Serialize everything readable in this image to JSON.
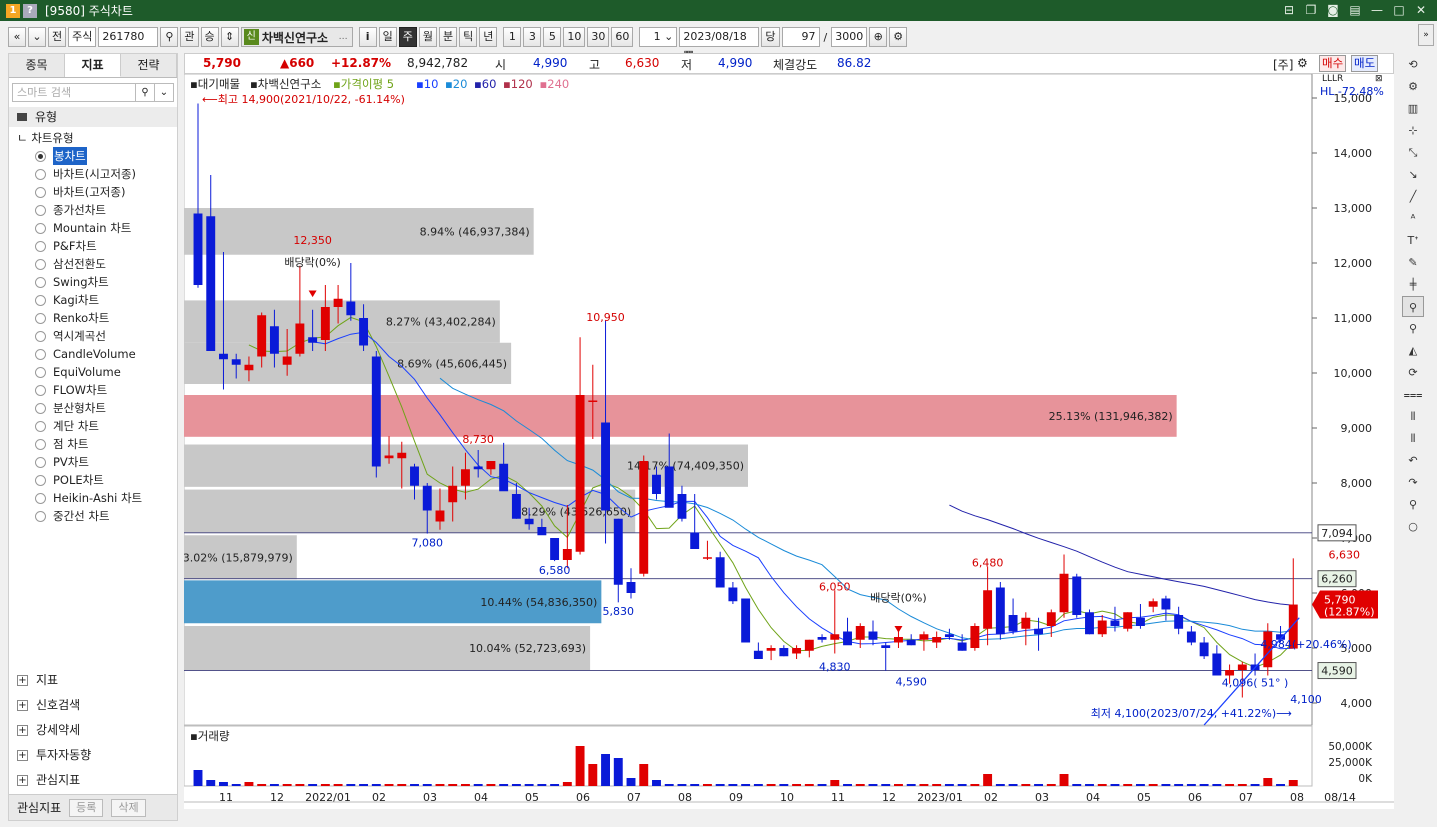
{
  "titlebar": {
    "icon1": "1",
    "icon2": "?",
    "title": "[9580] 주식차트",
    "controls": [
      "pin-icon",
      "copy-icon",
      "camera-icon",
      "print-icon",
      "minimize-icon",
      "maximize-icon",
      "close-icon"
    ]
  },
  "toolbar": {
    "prev": "«",
    "next": "»",
    "market": "전",
    "type": "주식",
    "code": "261780",
    "gwan": "관",
    "seung": "승",
    "badge": "신",
    "corp_name": "차백신연구소",
    "info": "i",
    "periods": [
      "일",
      "주",
      "월",
      "분",
      "틱",
      "년"
    ],
    "active_period": "주",
    "units": [
      "1",
      "3",
      "5",
      "10",
      "30",
      "60"
    ],
    "unit_select": "1",
    "date": "2023/08/18",
    "dang": "당",
    "count": "97",
    "slash": "/",
    "total": "3000"
  },
  "left_panel": {
    "tabs": [
      "종목",
      "지표",
      "전략"
    ],
    "active_tab": "지표",
    "search_placeholder": "스마트 검색",
    "section": "유형",
    "tree_root": "차트유형",
    "selected": "봉차트",
    "items": [
      "봉차트",
      "바차트(시고저종)",
      "바차트(고저종)",
      "종가선차트",
      "Mountain 차트",
      "P&F차트",
      "삼선전환도",
      "Swing차트",
      "Kagi차트",
      "Renko차트",
      "역시계곡선",
      "CandleVolume",
      "EquiVolume",
      "FLOW차트",
      "분산형차트",
      "계단 차트",
      "점 차트",
      "PV차트",
      "POLE차트",
      "Heikin-Ashi 차트",
      "중간선 차트"
    ],
    "groups": [
      "지표",
      "신호검색",
      "강세약세",
      "투자자동향",
      "관심지표"
    ],
    "bottom_label": "관심지표",
    "bottom_buttons": [
      "등록",
      "삭제"
    ]
  },
  "infobar": {
    "price": "5,790",
    "change": "▲660",
    "change_pct": "+12.87%",
    "volume": "8,942,782",
    "open_label": "시",
    "open": "4,990",
    "high_label": "고",
    "high": "6,630",
    "low_label": "저",
    "low": "4,990",
    "strength_label": "체결강도",
    "strength": "86.82",
    "ju": "[주]",
    "buy": "매수",
    "sell": "매도"
  },
  "chart_data": {
    "type": "candlestick",
    "legend": [
      "대기매물",
      "차백신연구소",
      "가격이평 5",
      "10",
      "20",
      "60",
      "120",
      "240"
    ],
    "legend_colors": [
      "#222222",
      "#222222",
      "#6fa318",
      "#1a3fff",
      "#1a8bd8",
      "#2222aa",
      "#b0304a",
      "#e07090"
    ],
    "y_ticks": [
      4000,
      5000,
      6000,
      7000,
      8000,
      9000,
      10000,
      11000,
      12000,
      13000,
      14000,
      15000
    ],
    "y_tick_labels": [
      "4,000",
      "5,000",
      "6,000",
      "7,000",
      "8,000",
      "9,000",
      "10,000",
      "11,000",
      "12,000",
      "13,000",
      "14,000",
      "15,000"
    ],
    "ylim": [
      3600,
      15400
    ],
    "x_labels": [
      "11",
      "12",
      "2022/01",
      "02",
      "03",
      "04",
      "05",
      "06",
      "07",
      "08",
      "09",
      "10",
      "11",
      "12",
      "2023/01",
      "02",
      "03",
      "04",
      "05",
      "06",
      "07",
      "08",
      "08/14"
    ],
    "hl_label": "HL -72.48%",
    "volume_profile": [
      {
        "price_low": 12150,
        "price_high": 13000,
        "label": "8.94% (46,937,384)",
        "len": 0.31,
        "highlight": "none"
      },
      {
        "price_low": 10550,
        "price_high": 11320,
        "label": "8.27% (43,402,284)",
        "len": 0.28,
        "highlight": "none"
      },
      {
        "price_low": 9800,
        "price_high": 10550,
        "label": "8.69% (45,606,445)",
        "len": 0.29,
        "highlight": "none"
      },
      {
        "price_low": 8840,
        "price_high": 9600,
        "label": "25.13% (131,946,382)",
        "len": 0.88,
        "highlight": "red"
      },
      {
        "price_low": 7930,
        "price_high": 8700,
        "label": "14.17% (74,409,350)",
        "len": 0.5,
        "highlight": "none"
      },
      {
        "price_low": 7090,
        "price_high": 7880,
        "label": "8.29% (43,526,650)",
        "len": 0.4,
        "highlight": "none"
      },
      {
        "price_low": 6250,
        "price_high": 7050,
        "label": "3.02% (15,879,979)",
        "len": 0.1,
        "highlight": "none"
      },
      {
        "price_low": 5450,
        "price_high": 6230,
        "label": "10.44% (54,836,350)",
        "len": 0.37,
        "highlight": "blue"
      },
      {
        "price_low": 4600,
        "price_high": 5400,
        "label": "10.04% (52,723,693)",
        "len": 0.36,
        "highlight": "none"
      }
    ],
    "candles": [
      [
        12900,
        14900,
        11550,
        11600
      ],
      [
        12850,
        13600,
        10550,
        10400
      ],
      [
        10350,
        12200,
        9700,
        10250
      ],
      [
        10250,
        10350,
        9900,
        10150
      ],
      [
        10050,
        10300,
        9850,
        10150
      ],
      [
        10300,
        11100,
        10100,
        11050
      ],
      [
        10850,
        11150,
        10100,
        10350
      ],
      [
        10150,
        10800,
        9950,
        10300
      ],
      [
        10350,
        11950,
        10300,
        10900
      ],
      [
        10650,
        11150,
        10400,
        10550
      ],
      [
        10600,
        11600,
        10400,
        11200
      ],
      [
        11200,
        11600,
        10900,
        11350
      ],
      [
        11300,
        12000,
        10950,
        11050
      ],
      [
        11000,
        11250,
        10400,
        10500
      ],
      [
        10300,
        10400,
        8100,
        8300
      ],
      [
        8450,
        8850,
        8350,
        8500
      ],
      [
        8450,
        8750,
        7900,
        8550
      ],
      [
        8300,
        8350,
        7700,
        7950
      ],
      [
        7950,
        8000,
        7080,
        7500
      ],
      [
        7300,
        7900,
        7150,
        7500
      ],
      [
        7650,
        8300,
        7300,
        7950
      ],
      [
        7950,
        8550,
        7700,
        8250
      ],
      [
        8300,
        8600,
        8100,
        8250
      ],
      [
        8250,
        8350,
        8150,
        8400
      ],
      [
        8350,
        8730,
        8100,
        7850
      ],
      [
        7800,
        8000,
        7350,
        7350
      ],
      [
        7350,
        7550,
        7150,
        7250
      ],
      [
        7200,
        7350,
        7100,
        7050
      ],
      [
        7000,
        7000,
        6580,
        6600
      ],
      [
        6600,
        7600,
        6450,
        6800
      ],
      [
        6750,
        10650,
        6700,
        9600
      ],
      [
        9500,
        10150,
        8800,
        9500
      ],
      [
        9100,
        10950,
        6900,
        7500
      ],
      [
        7350,
        7350,
        5830,
        6150
      ],
      [
        6200,
        6450,
        5900,
        6000
      ],
      [
        6350,
        8500,
        6300,
        8400
      ],
      [
        8150,
        8300,
        7700,
        7800
      ],
      [
        8300,
        8900,
        7600,
        7550
      ],
      [
        7800,
        7950,
        7300,
        7350
      ],
      [
        7100,
        7800,
        6850,
        6800
      ],
      [
        6650,
        6950,
        6600,
        6650
      ],
      [
        6650,
        6750,
        6100,
        6100
      ],
      [
        6100,
        6200,
        5800,
        5850
      ],
      [
        5900,
        5900,
        5100,
        5100
      ],
      [
        4950,
        5100,
        4800,
        4800
      ],
      [
        4950,
        5050,
        4780,
        5000
      ],
      [
        5000,
        5050,
        4850,
        4850
      ],
      [
        4900,
        5050,
        4800,
        5000
      ],
      [
        4950,
        5150,
        4830,
        5150
      ],
      [
        5200,
        5250,
        5100,
        5150
      ],
      [
        5150,
        6050,
        4900,
        5250
      ],
      [
        5300,
        5550,
        5180,
        5050
      ],
      [
        5150,
        5450,
        5000,
        5400
      ],
      [
        5300,
        5500,
        5050,
        5150
      ],
      [
        5050,
        5100,
        4590,
        5000
      ],
      [
        5100,
        5300,
        5000,
        5200
      ],
      [
        5150,
        5250,
        5050,
        5050
      ],
      [
        5150,
        5300,
        4950,
        5250
      ],
      [
        5100,
        5300,
        5000,
        5200
      ],
      [
        5250,
        5350,
        5150,
        5200
      ],
      [
        5100,
        5250,
        4950,
        4950
      ],
      [
        5000,
        5450,
        4950,
        5400
      ],
      [
        5350,
        6480,
        5050,
        6050
      ],
      [
        6100,
        6200,
        5150,
        5250
      ],
      [
        5600,
        5900,
        5250,
        5300
      ],
      [
        5350,
        5650,
        5050,
        5550
      ],
      [
        5350,
        5550,
        4950,
        5250
      ],
      [
        5400,
        5700,
        5200,
        5650
      ],
      [
        5650,
        6700,
        5550,
        6350
      ],
      [
        6300,
        6350,
        5550,
        5600
      ],
      [
        5650,
        5700,
        5250,
        5250
      ],
      [
        5250,
        5600,
        5200,
        5500
      ],
      [
        5500,
        5750,
        5300,
        5400
      ],
      [
        5350,
        5650,
        5300,
        5650
      ],
      [
        5550,
        5800,
        5350,
        5400
      ],
      [
        5750,
        5900,
        5650,
        5850
      ],
      [
        5900,
        5950,
        5500,
        5700
      ],
      [
        5600,
        5750,
        5250,
        5350
      ],
      [
        5300,
        5400,
        5050,
        5100
      ],
      [
        5100,
        5200,
        4800,
        4850
      ],
      [
        4900,
        5050,
        4550,
        4500
      ],
      [
        4500,
        4700,
        4350,
        4600
      ],
      [
        4600,
        4750,
        4100,
        4700
      ],
      [
        4700,
        4900,
        4500,
        4600
      ],
      [
        4650,
        5450,
        4500,
        5300
      ],
      [
        5250,
        5400,
        5100,
        5150
      ],
      [
        4990,
        6630,
        4990,
        5790
      ]
    ],
    "annotations": [
      {
        "text": "⟵최고 14,900(2021/10/22, -61.14%)",
        "kind": "max"
      },
      {
        "text": "12,350",
        "kind": "red"
      },
      {
        "text": "배당락(0%)",
        "kind": "black"
      },
      {
        "text": "10,950",
        "kind": "red"
      },
      {
        "text": "8,730",
        "kind": "red"
      },
      {
        "text": "7,080",
        "kind": "blue"
      },
      {
        "text": "6,580",
        "kind": "blue"
      },
      {
        "text": "5,830",
        "kind": "blue"
      },
      {
        "text": "6,050",
        "kind": "red"
      },
      {
        "text": "배당락(0%)",
        "kind": "black"
      },
      {
        "text": "4,830",
        "kind": "blue"
      },
      {
        "text": "4,590",
        "kind": "blue"
      },
      {
        "text": "6,480",
        "kind": "red"
      },
      {
        "text": "6,630",
        "kind": "red"
      },
      {
        "text": "4,984(+20.46%)",
        "kind": "blue"
      },
      {
        "text": "4,096( 51° )",
        "kind": "blue"
      },
      {
        "text": "4,100",
        "kind": "blue"
      },
      {
        "text": "최저 4,100(2023/07/24, +41.22%)⟶",
        "kind": "min"
      }
    ],
    "price_lines": [
      {
        "value": 7094,
        "label": "7,094",
        "bg": "#ffffff",
        "fg": "#222222"
      },
      {
        "value": 6260,
        "label": "6,260",
        "bg": "#e8f3e6",
        "fg": "#222222"
      },
      {
        "value": 4590,
        "label": "4,590",
        "bg": "#e8f3e6",
        "fg": "#222222"
      }
    ],
    "current_price": {
      "value": 5790,
      "label1": "5,790",
      "label2": "(12.87%)"
    },
    "volume_title": "거래량",
    "volume_ticks": [
      "50,000K",
      "25,000K",
      "0K"
    ],
    "volumes": [
      8,
      3,
      2,
      1,
      2,
      1,
      1,
      1,
      1,
      1,
      1,
      1,
      1,
      1,
      1,
      1,
      1,
      1,
      1,
      1,
      1,
      1,
      1,
      1,
      1,
      1,
      1,
      1,
      1,
      2,
      20,
      11,
      16,
      14,
      4,
      11,
      3,
      1,
      1,
      1,
      1,
      1,
      1,
      1,
      1,
      1,
      1,
      1,
      1,
      1,
      3,
      1,
      1,
      1,
      1,
      1,
      1,
      1,
      1,
      1,
      1,
      1,
      6,
      1,
      1,
      1,
      1,
      1,
      6,
      1,
      1,
      1,
      1,
      1,
      1,
      1,
      1,
      1,
      1,
      1,
      1,
      1,
      1,
      1,
      4,
      1,
      3
    ]
  },
  "right_toolbar": [
    "refresh-icon",
    "settings-icon",
    "chart-type-icon",
    "crosshair-icon",
    "trendline-icon",
    "angle-line-icon",
    "diagonal-line-icon",
    "auto-icon",
    "text-tool-icon",
    "drawing-icon",
    "candle-icon",
    "zoom-icon",
    "zoom-fit-icon",
    "pattern-icon",
    "cycle-icon",
    "fib-icon",
    "vertical-lines-icon",
    "grid-lines-icon",
    "undo-icon",
    "redo-icon",
    "search-icon",
    "circle-icon"
  ]
}
